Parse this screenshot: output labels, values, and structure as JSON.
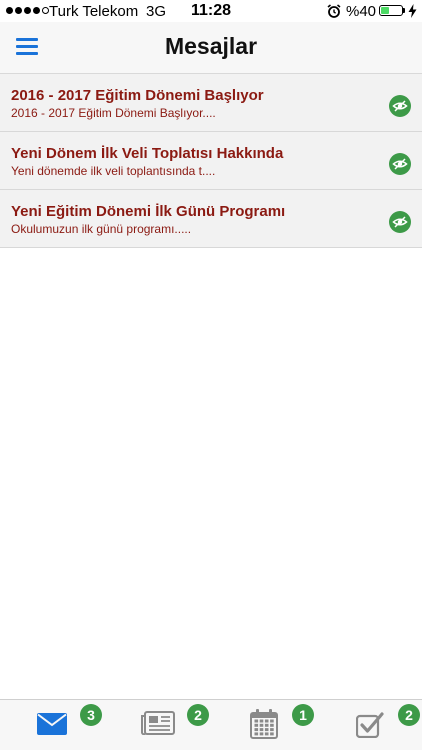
{
  "status_bar": {
    "carrier": "Turk Telekom",
    "network": "3G",
    "time": "11:28",
    "battery_text": "%40",
    "battery_level": 0.4
  },
  "header": {
    "title": "Mesajlar"
  },
  "messages": [
    {
      "title": "2016 - 2017 Eğitim Dönemi Başlıyor",
      "preview": "2016 - 2017 Eğitim Dönemi Başlıyor....",
      "icon": "read-eye-icon"
    },
    {
      "title": "Yeni Dönem İlk Veli Toplatısı Hakkında",
      "preview": "Yeni dönemde ilk veli toplantısında t....",
      "icon": "read-eye-icon"
    },
    {
      "title": "Yeni Eğitim Dönemi İlk Günü Programı",
      "preview": "Okulumuzun ilk günü programı.....",
      "icon": "read-eye-icon"
    }
  ],
  "tabs": [
    {
      "icon": "envelope-icon",
      "badge": "3",
      "active": true
    },
    {
      "icon": "newspaper-icon",
      "badge": "2",
      "active": false
    },
    {
      "icon": "calendar-icon",
      "badge": "1",
      "active": false
    },
    {
      "icon": "checkbox-icon",
      "badge": "2",
      "active": false
    }
  ],
  "colors": {
    "accent": "#1a73d9",
    "title_text": "#8b1a12",
    "badge_green": "#3d9a48",
    "row_background": "#f2f2f2",
    "inactive_icon": "#8a8a8a"
  }
}
